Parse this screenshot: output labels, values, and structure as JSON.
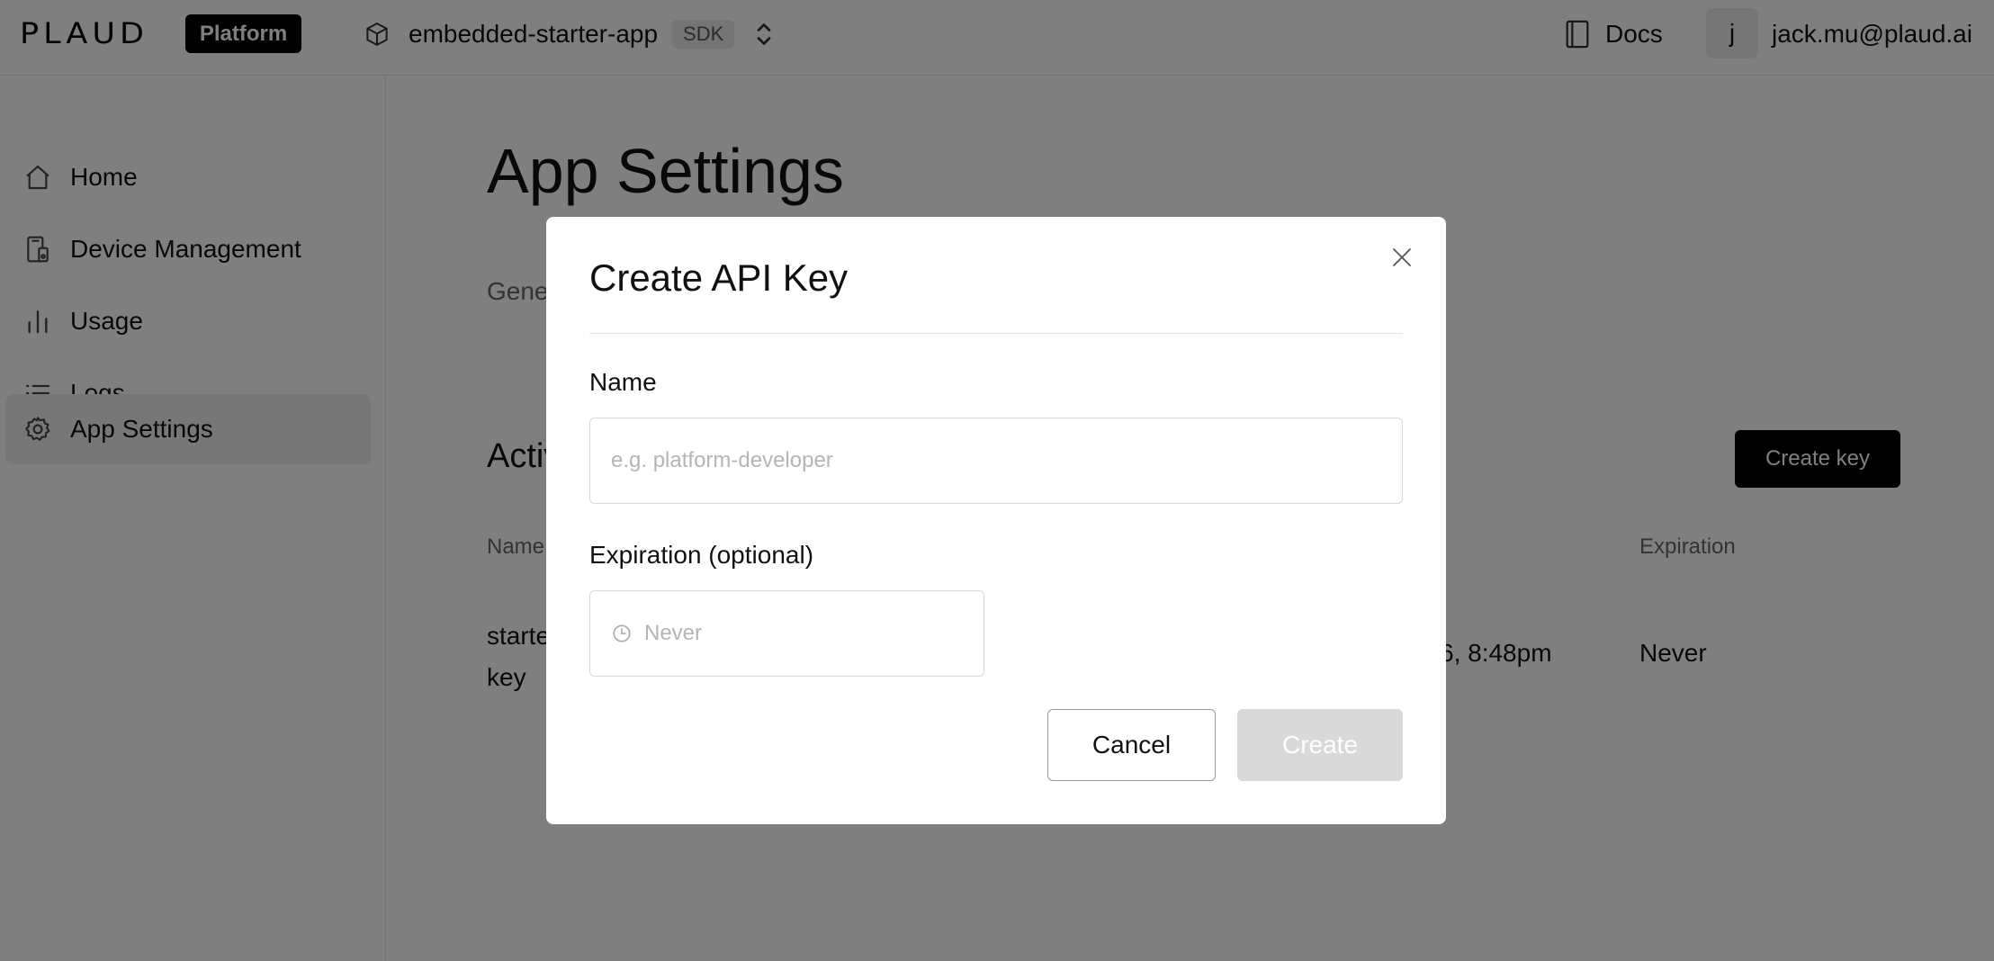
{
  "header": {
    "logo_text": "PLAUD",
    "platform_badge": "Platform",
    "app_name": "embedded-starter-app",
    "app_badge": "SDK",
    "docs_label": "Docs",
    "avatar_initial": "j",
    "user_email": "jack.mu@plaud.ai"
  },
  "sidebar": {
    "items": [
      {
        "label": "Home",
        "icon": "home-icon",
        "active": false
      },
      {
        "label": "Device Management",
        "icon": "device-icon",
        "active": false
      },
      {
        "label": "Usage",
        "icon": "bar-chart-icon",
        "active": false
      },
      {
        "label": "Logs",
        "icon": "list-icon",
        "active": false
      },
      {
        "label": "App Settings",
        "icon": "gear-icon",
        "active": true
      }
    ]
  },
  "main": {
    "page_title": "App Settings",
    "tab_general_partial": "Gene",
    "section_title_partial": "Activ",
    "create_key_label": "Create key",
    "columns": {
      "name_partial": "Name",
      "expiration": "Expiration"
    },
    "row": {
      "name_partial": "starte key",
      "created_partial": "6, 8:48pm",
      "expiration": "Never"
    }
  },
  "modal": {
    "title": "Create API Key",
    "name_label": "Name",
    "name_value": "",
    "name_placeholder": "e.g. platform-developer",
    "expiration_label": "Expiration (optional)",
    "expiration_value": "Never",
    "cancel_label": "Cancel",
    "create_label": "Create"
  },
  "colors": {
    "overlay": "rgba(0,0,0,0.5)",
    "primary_button": "#000000",
    "disabled_button": "#d9d9d9",
    "sidebar_active": "#efefef"
  }
}
